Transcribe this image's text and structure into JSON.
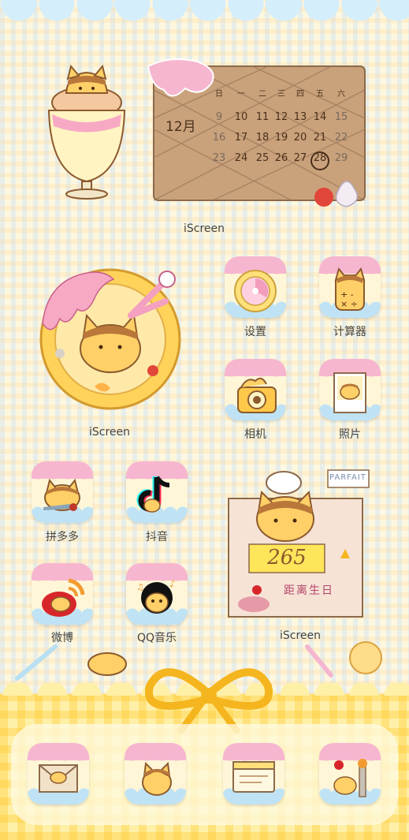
{
  "widgets": {
    "calendar": {
      "label": "iScreen",
      "month": "12月",
      "weekdays": [
        "日",
        "一",
        "二",
        "三",
        "四",
        "五",
        "六"
      ],
      "weeks": [
        [
          "9",
          "10",
          "11",
          "12",
          "13",
          "14",
          "15"
        ],
        [
          "16",
          "17",
          "18",
          "19",
          "20",
          "21",
          "22"
        ],
        [
          "23",
          "24",
          "25",
          "26",
          "27",
          "28",
          "29"
        ]
      ],
      "today": "28"
    },
    "clock": {
      "label": "iScreen"
    },
    "countdown": {
      "label": "iScreen",
      "tag": "PARFAIT",
      "days": "265",
      "caption": "距离生日"
    }
  },
  "apps": [
    {
      "id": "settings",
      "label": "设置"
    },
    {
      "id": "calculator",
      "label": "计算器"
    },
    {
      "id": "camera",
      "label": "相机"
    },
    {
      "id": "photos",
      "label": "照片"
    },
    {
      "id": "pinduoduo",
      "label": "拼多多"
    },
    {
      "id": "douyin",
      "label": "抖音"
    },
    {
      "id": "weibo",
      "label": "微博"
    },
    {
      "id": "qqmusic",
      "label": "QQ音乐"
    }
  ],
  "colors": {
    "pink": "#f7b6cf",
    "blue": "#bfe3f5",
    "caramel": "#b9773a",
    "cream": "#fff6d8",
    "yellow": "#ffd43b"
  }
}
